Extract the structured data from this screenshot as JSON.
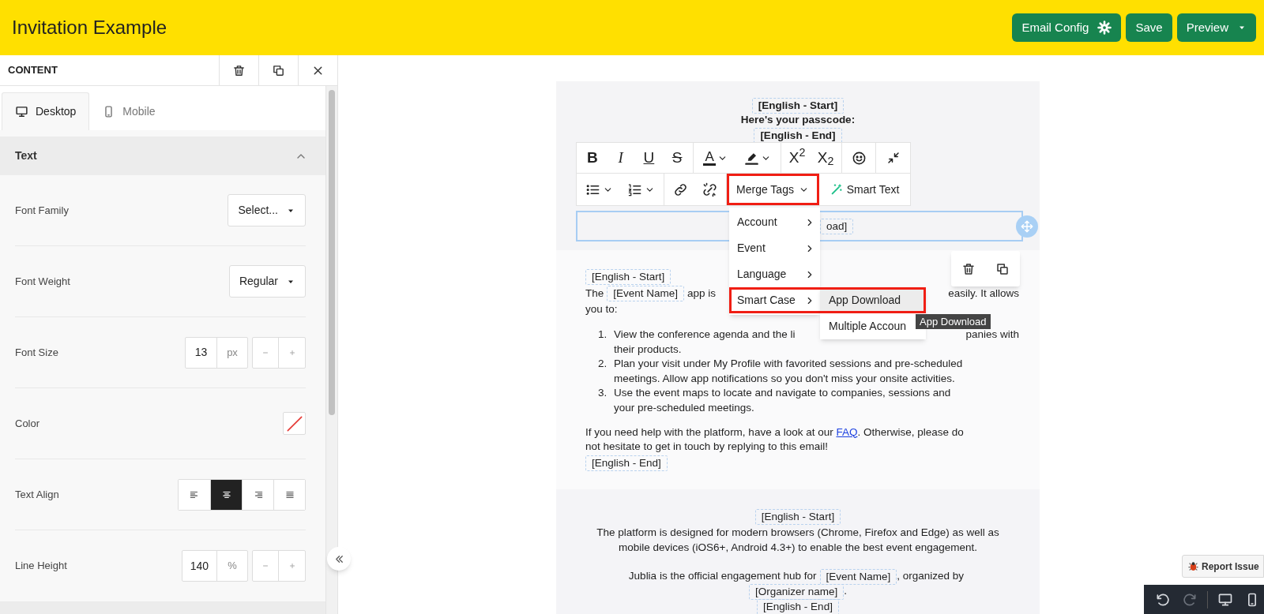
{
  "header": {
    "title": "Invitation Example",
    "buttons": [
      {
        "label": "Email Config",
        "kind": "settings"
      },
      {
        "label": "Save",
        "kind": "plain"
      },
      {
        "label": "Preview",
        "kind": "dropdown"
      }
    ]
  },
  "panel": {
    "title": "CONTENT",
    "tabs": [
      {
        "label": "Desktop",
        "kind": "desktop",
        "selected": true
      },
      {
        "label": "Mobile",
        "kind": "mobile",
        "selected": false
      }
    ],
    "section": {
      "title": "Text",
      "expanded": true
    },
    "properties": [
      {
        "label": "Font Family",
        "kind": "select",
        "value": "Select..."
      },
      {
        "label": "Font Weight",
        "kind": "select",
        "value": "Regular"
      },
      {
        "label": "Font Size",
        "kind": "number",
        "value": "13",
        "unit": "px"
      },
      {
        "label": "Color",
        "kind": "color"
      },
      {
        "label": "Text Align",
        "kind": "align",
        "options": [
          {
            "kind": "left",
            "selected": false
          },
          {
            "kind": "center",
            "selected": true
          },
          {
            "kind": "right",
            "selected": false
          },
          {
            "kind": "justify",
            "selected": false
          }
        ]
      },
      {
        "label": "Line Height",
        "kind": "number",
        "value": "140",
        "unit": "%"
      }
    ]
  },
  "email": {
    "header_block": [
      {
        "kind": "tag",
        "text": "[English - Start]"
      },
      {
        "kind": "text",
        "text": "Here's your passcode:"
      },
      {
        "kind": "tag",
        "text": "[English - End]"
      }
    ],
    "selected_block": {
      "visible_tag": "oad]"
    },
    "intro": {
      "start_tag": "[English - Start]",
      "lines": [
        [
          {
            "kind": "text",
            "text": "The"
          },
          {
            "kind": "tag",
            "text": "[Event Name]"
          },
          {
            "kind": "text",
            "text": "app is"
          },
          {
            "kind": "covered"
          },
          {
            "kind": "text",
            "text": "easily. It allows"
          }
        ],
        [
          {
            "kind": "text",
            "text": "you to:"
          }
        ]
      ],
      "list": [
        {
          "number": "1.",
          "lines": [
            [
              {
                "kind": "text",
                "text": "View the conference agenda and the li"
              },
              {
                "kind": "covered"
              },
              {
                "kind": "text",
                "text": "panies with"
              }
            ],
            [
              {
                "kind": "text",
                "text": "their products."
              }
            ]
          ]
        },
        {
          "number": "2.",
          "text": "Plan your visit under My Profile with favorited sessions and pre-scheduled\nmeetings. Allow app notifications so you don't miss your onsite activities."
        },
        {
          "number": "3.",
          "text": "Use the event maps to locate and navigate to companies, sessions and\nyour pre-scheduled meetings."
        }
      ],
      "help": [
        {
          "kind": "text",
          "text": "If you need help with the platform, have a look at our "
        },
        {
          "kind": "link",
          "text": "FAQ"
        },
        {
          "kind": "text",
          "text": ". Otherwise, please do\nnot hesitate to get in touch by replying to this email!"
        }
      ],
      "end_tag": "[English - End]"
    },
    "footer": {
      "start_tag": "[English - Start]",
      "paragraph": "The platform is designed for modern browsers (Chrome, Firefox and Edge) as well as\nmobile devices (iOS6+, Android 4.3+) to enable the best event engagement.",
      "lines": [
        [
          {
            "kind": "text",
            "text": "Jublia is the official engagement hub for"
          },
          {
            "kind": "tag",
            "text": "[Event Name]"
          },
          {
            "kind": "text",
            "text": ", organized by"
          }
        ],
        [
          {
            "kind": "tag",
            "text": "[Organizer name]"
          },
          {
            "kind": "text",
            "text": "."
          }
        ]
      ],
      "end_tag": "[English - End]"
    }
  },
  "toolbar": {
    "row_1": [
      {
        "kind": "bold",
        "glyph": "B"
      },
      {
        "kind": "italic",
        "glyph": "I"
      },
      {
        "kind": "underline",
        "glyph": "U"
      },
      {
        "kind": "strike",
        "glyph": "S"
      },
      {
        "kind": "font_color",
        "glyph": "A"
      },
      {
        "kind": "highlight"
      },
      {
        "kind": "superscript",
        "glyph": "X$^{2}$"
      },
      {
        "kind": "subscript",
        "glyph": "X$_{2}$"
      },
      {
        "kind": "emoji"
      },
      {
        "kind": "collapse"
      }
    ],
    "row_2": [
      {
        "kind": "bullets"
      },
      {
        "kind": "numbers"
      },
      {
        "kind": "link"
      },
      {
        "kind": "unlink"
      },
      {
        "kind": "merge",
        "label": "Merge Tags",
        "annotated": true
      },
      {
        "kind": "smart",
        "label": "Smart Text"
      }
    ]
  },
  "merge_menu": [
    {
      "label": "Account",
      "annotated": false
    },
    {
      "label": "Event",
      "annotated": false
    },
    {
      "label": "Language",
      "annotated": false
    },
    {
      "label": "Smart Case",
      "annotated": true
    }
  ],
  "submenu": [
    {
      "label": "App Download",
      "selected": true,
      "annotated": true
    },
    {
      "label": "Multiple Accoun",
      "selected": false,
      "annotated": false
    }
  ],
  "tooltip": "App Download",
  "report_button": "Report Issue",
  "bottom_bar": [
    {
      "kind": "undo",
      "disabled": false
    },
    {
      "kind": "redo",
      "disabled": true
    },
    {
      "kind": "desktop",
      "disabled": false
    },
    {
      "kind": "mobile",
      "disabled": false
    }
  ]
}
